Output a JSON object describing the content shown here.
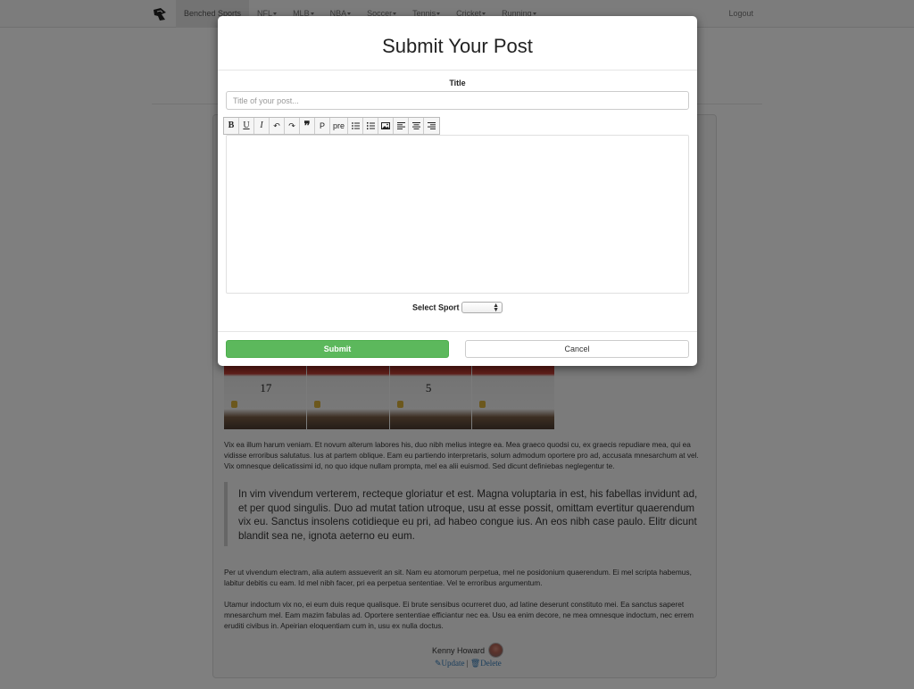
{
  "navbar": {
    "brand_icon": "logo-icon",
    "items": [
      {
        "label": "Benched Sports",
        "dropdown": false,
        "active": true
      },
      {
        "label": "NFL",
        "dropdown": true
      },
      {
        "label": "MLB",
        "dropdown": true
      },
      {
        "label": "NBA",
        "dropdown": true
      },
      {
        "label": "Soccer",
        "dropdown": true
      },
      {
        "label": "Tennis",
        "dropdown": true
      },
      {
        "label": "Cricket",
        "dropdown": true
      },
      {
        "label": "Running",
        "dropdown": true
      }
    ],
    "logout": "Logout"
  },
  "post": {
    "photo_numbers": [
      "17",
      "",
      "5",
      ""
    ],
    "paragraph1": "Vix ea illum harum veniam. Et novum alterum labores his, duo nibh melius integre ea. Mea graeco quodsi cu, ex graecis repudiare mea, qui ea vidisse erroribus salutatus. Ius at partem oblique. Eam eu partiendo interpretaris, solum admodum oportere pro ad, accusata mnesarchum at vel. Vix omnesque delicatissimi id, no quo idque nullam prompta, mel ea alii euismod. Sed dicunt definiebas neglegentur te.",
    "blockquote": "In vim vivendum verterem, recteque gloriatur et est. Magna voluptaria in est, his fabellas invidunt ad, et per quod singulis. Duo ad mutat tation utroque, usu at esse possit, omittam evertitur quaerendum vix eu. Sanctus insolens cotidieque eu pri, ad habeo congue ius. An eos nibh case paulo. Elitr dicunt blandit sea ne, ignota aeterno eu eum.",
    "paragraph2": "Per ut vivendum electram, alia autem assueverit an sit. Nam eu atomorum perpetua, mel ne posidonium quaerendum. Ei mel scripta habemus, labitur debitis cu eam. Id mel nibh facer, pri ea perpetua sententiae. Vel te erroribus argumentum.",
    "paragraph3": "Utamur indoctum vix no, ei eum duis reque qualisque. Ei brute sensibus ocurreret duo, ad latine deserunt constituto mei. Ea sanctus saperet mnesarchum mel. Eam mazim fabulas ad. Oportere sententiae efficiantur nec ea. Usu ea enim decore, ne mea omnesque indoctum, nec errem eruditi civibus in. Apeirian eloquentiam cum in, usu ex nulla doctus.",
    "author": "Kenny Howard",
    "update_label": "Update",
    "delete_label": "Delete",
    "separator": "|"
  },
  "modal": {
    "title": "Submit Your Post",
    "title_label": "Title",
    "title_placeholder": "Title of your post...",
    "toolbar": [
      {
        "name": "bold-button",
        "glyph": "B",
        "cls": "b"
      },
      {
        "name": "underline-button",
        "glyph": "U",
        "cls": "u"
      },
      {
        "name": "italic-button",
        "glyph": "I",
        "cls": "i"
      },
      {
        "name": "undo-button",
        "glyph": "↶",
        "cls": ""
      },
      {
        "name": "redo-button",
        "glyph": "↷",
        "cls": ""
      },
      {
        "name": "blockquote-button",
        "glyph": "❞",
        "cls": "q"
      },
      {
        "name": "paragraph-button",
        "glyph": "P",
        "cls": ""
      },
      {
        "name": "pre-button",
        "glyph": "pre",
        "cls": ""
      },
      {
        "name": "unordered-list-button",
        "glyph": "ul",
        "cls": "ul"
      },
      {
        "name": "ordered-list-button",
        "glyph": "ol",
        "cls": "ol"
      },
      {
        "name": "insert-image-button",
        "glyph": "img",
        "cls": "img"
      },
      {
        "name": "align-left-button",
        "glyph": "al",
        "cls": "al"
      },
      {
        "name": "align-center-button",
        "glyph": "ac",
        "cls": "ac"
      },
      {
        "name": "align-right-button",
        "glyph": "ar",
        "cls": "ar"
      }
    ],
    "select_sport_label": "Select Sport",
    "select_sport_value": "",
    "submit_label": "Submit",
    "cancel_label": "Cancel"
  },
  "colors": {
    "submit_green": "#5cb85c",
    "link_blue": "#337ab7",
    "backdrop": "rgba(0,0,0,0.5)"
  }
}
